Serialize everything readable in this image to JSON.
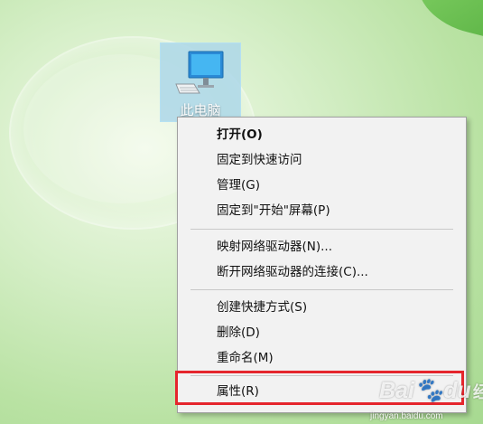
{
  "desktop": {
    "icon_label": "此电脑"
  },
  "context_menu": {
    "items": [
      {
        "label": "打开(O)"
      },
      {
        "label": "固定到快速访问"
      },
      {
        "label": "管理(G)"
      },
      {
        "label": "固定到\"开始\"屏幕(P)"
      },
      {
        "label": "映射网络驱动器(N)..."
      },
      {
        "label": "断开网络驱动器的连接(C)..."
      },
      {
        "label": "创建快捷方式(S)"
      },
      {
        "label": "删除(D)"
      },
      {
        "label": "重命名(M)"
      },
      {
        "label": "属性(R)"
      }
    ]
  },
  "highlight": {
    "target": "属性(R)",
    "color": "#e5262d"
  },
  "watermark": {
    "logo_a": "Bai",
    "logo_b": "du",
    "logo_cn": "经验",
    "url": "jingyan.baidu.com"
  },
  "colors": {
    "menu_background": "#f2f2f2",
    "icon_selection": "#add7e9",
    "wallpaper": "#c8e8b4"
  }
}
